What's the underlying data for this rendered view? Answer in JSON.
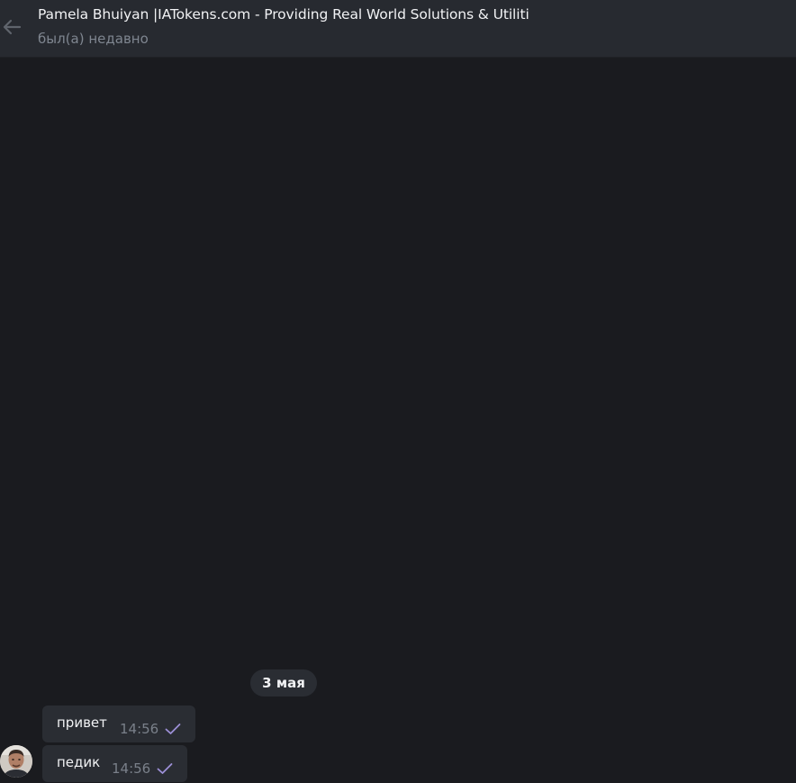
{
  "header": {
    "title": "Pamela Bhuiyan |IATokens.com - Providing Real World Solutions & Utiliti",
    "status": "был(а) недавно",
    "back_icon": "arrow-left-icon"
  },
  "chat": {
    "date_separator": "3 мая",
    "messages": [
      {
        "text": "привет",
        "time": "14:56",
        "status_icon": "single-check-icon"
      },
      {
        "text": "педик",
        "time": "14:56",
        "status_icon": "single-check-icon"
      }
    ],
    "avatar_icon": "user-avatar"
  },
  "colors": {
    "background": "#1a1b1f",
    "header": "#272a30",
    "bubble": "#2a2d33",
    "text": "#f1f2f4",
    "muted": "#7f8690",
    "check": "#9c8fd6"
  }
}
